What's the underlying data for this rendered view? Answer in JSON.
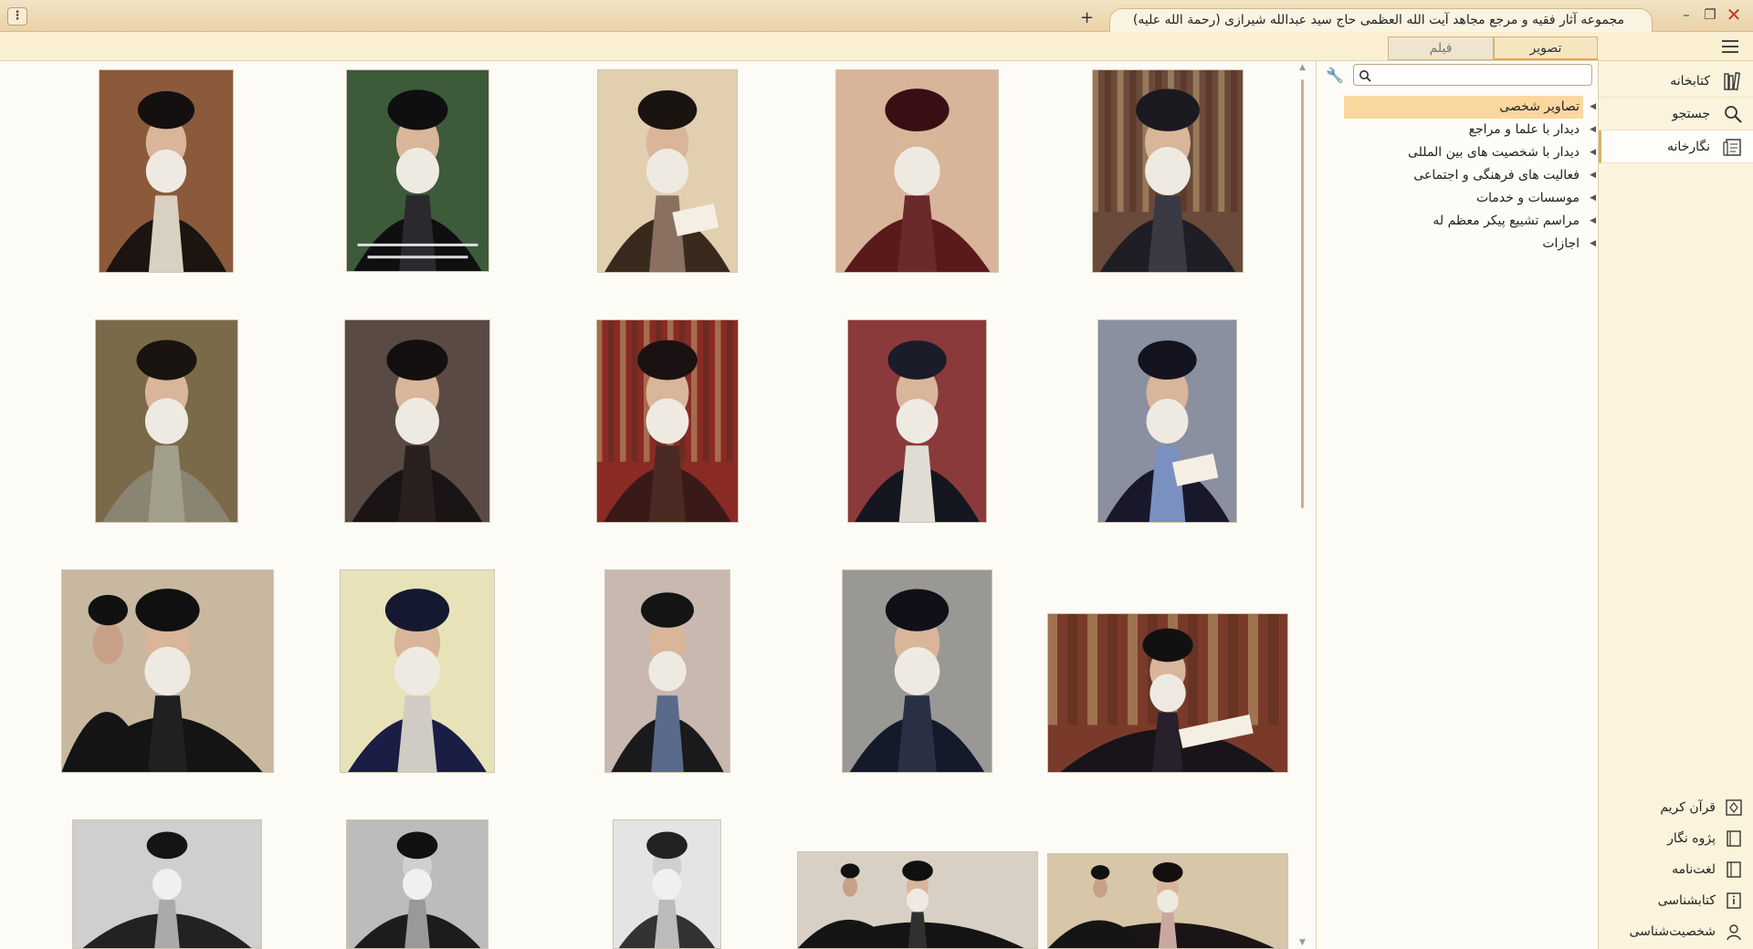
{
  "window": {
    "title": "مجموعه آثار فقیه و مرجع مجاهد آیت الله العظمی حاج سید عبدالله شیرازی (رحمة الله علیه)",
    "new_tab": "+",
    "menu_glyph": "⋮",
    "minimize": "–",
    "restore": "❐",
    "close": "✕"
  },
  "media_tabs": {
    "image": "تصویر",
    "film": "فیلم"
  },
  "search": {
    "placeholder": ""
  },
  "tree": {
    "items": [
      {
        "label": "تصاویر شخصی",
        "selected": true
      },
      {
        "label": "دیدار با علما و مراجع",
        "selected": false
      },
      {
        "label": "دیدار با شخصیت های بین المللی",
        "selected": false
      },
      {
        "label": "فعالیت های فرهنگی و اجتماعی",
        "selected": false
      },
      {
        "label": "موسسات و خدمات",
        "selected": false
      },
      {
        "label": "مراسم تشییع پیکر معظم له",
        "selected": false
      },
      {
        "label": "اجازات",
        "selected": false
      }
    ]
  },
  "sidebar": {
    "top_items": [
      {
        "label": "کتابخانه",
        "icon": "library-icon"
      },
      {
        "label": "جستجو",
        "icon": "search-icon"
      },
      {
        "label": "نگارخانه",
        "icon": "gallery-icon"
      }
    ],
    "bottom_items": [
      {
        "label": "قرآن کریم",
        "icon": "quran-icon"
      },
      {
        "label": "پژوه نگار",
        "icon": "notebook-icon"
      },
      {
        "label": "لغت‌نامه",
        "icon": "dictionary-icon"
      },
      {
        "label": "کتابشناسی",
        "icon": "info-book-icon"
      },
      {
        "label": "شخصیت‌شناسی",
        "icon": "person-icon"
      }
    ]
  },
  "gallery": {
    "photos": [
      {
        "kind": "color",
        "scene": "portrait",
        "bg": "#8a5a3a",
        "robe": "#1b1410",
        "hat": "#151010",
        "shirt": "#d8d0c0"
      },
      {
        "kind": "color",
        "scene": "portrait-caption",
        "bg": "#3d5a3a",
        "robe": "#0f0f12",
        "hat": "#0f0f12",
        "shirt": "#2a2a2e"
      },
      {
        "kind": "color",
        "scene": "reading",
        "bg": "#e2cfb0",
        "robe": "#3a2a1e",
        "hat": "#1a1410",
        "shirt": "#8a7060"
      },
      {
        "kind": "color",
        "scene": "closeup",
        "bg": "#d8b49a",
        "robe": "#5a1a1c",
        "hat": "#3a0f14",
        "shirt": "#6a2a2c"
      },
      {
        "kind": "color",
        "scene": "bookshelf",
        "bg": "#6a4a3a",
        "robe": "#1e1e24",
        "hat": "#1a1a20",
        "shirt": "#3a3a44"
      },
      {
        "kind": "color",
        "scene": "crowd",
        "bg": "#7a6a4a",
        "robe": "#8a8472",
        "hat": "#1a1410",
        "shirt": "#a29e8c"
      },
      {
        "kind": "color",
        "scene": "profile",
        "bg": "#5a4a44",
        "robe": "#1a1414",
        "hat": "#141010",
        "shirt": "#2a2020"
      },
      {
        "kind": "color",
        "scene": "bookshelf-red",
        "bg": "#8a2a24",
        "robe": "#3a1a18",
        "hat": "#1a1212",
        "shirt": "#4a2a22"
      },
      {
        "kind": "color",
        "scene": "seated-rug",
        "bg": "#8a3a3a",
        "robe": "#141620",
        "hat": "#1a1c2a",
        "shirt": "#e0dcd4"
      },
      {
        "kind": "color",
        "scene": "reading-blue",
        "bg": "#8a90a0",
        "robe": "#18182a",
        "hat": "#141420",
        "shirt": "#7a90c0"
      },
      {
        "kind": "color",
        "scene": "meeting",
        "bg": "#c8b8a0",
        "robe": "#141414",
        "hat": "#101010",
        "shirt": "#202020"
      },
      {
        "kind": "color",
        "scene": "seated-light",
        "bg": "#e8e2b8",
        "robe": "#1a1e44",
        "hat": "#141830",
        "shirt": "#d0ccc4"
      },
      {
        "kind": "color",
        "scene": "profile-blue",
        "bg": "#c8b8b0",
        "robe": "#1a1a1c",
        "hat": "#141414",
        "shirt": "#5a6a8a"
      },
      {
        "kind": "color",
        "scene": "profile-dark",
        "bg": "#9a9894",
        "robe": "#141a2a",
        "hat": "#101018",
        "shirt": "#2a3044"
      },
      {
        "kind": "color",
        "scene": "library-reading",
        "bg": "#7a3a2a",
        "robe": "#18141a",
        "hat": "#121012",
        "shirt": "#28202a"
      },
      {
        "kind": "bw",
        "scene": "bw-seated",
        "bg": "#cfcfcf",
        "robe": "#222",
        "hat": "#151515",
        "shirt": "#aaa"
      },
      {
        "kind": "bw",
        "scene": "bw-seated-2",
        "bg": "#bcbcbc",
        "robe": "#1c1c1c",
        "hat": "#111",
        "shirt": "#999"
      },
      {
        "kind": "bw",
        "scene": "bw-portrait",
        "bg": "#e4e4e4",
        "robe": "#333",
        "hat": "#222",
        "shirt": "#bbb"
      },
      {
        "kind": "color",
        "scene": "meeting-2",
        "bg": "#d8d0c4",
        "robe": "#141414",
        "hat": "#101010",
        "shirt": "#303030"
      },
      {
        "kind": "color",
        "scene": "meeting-3",
        "bg": "#d8c6a8",
        "robe": "#1a1414",
        "hat": "#141010",
        "shirt": "#c8a8a0"
      }
    ]
  }
}
